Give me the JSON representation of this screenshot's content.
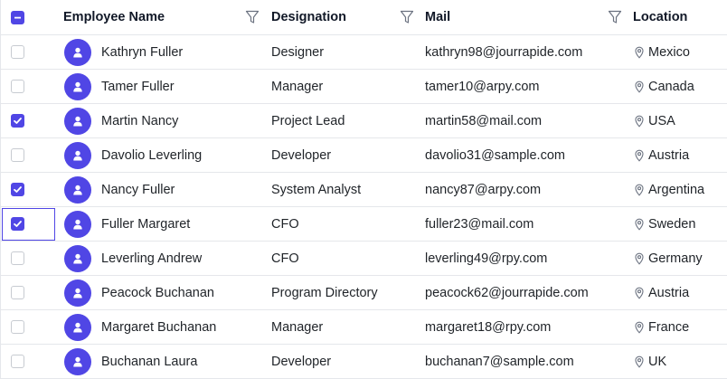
{
  "header": {
    "name": "Employee Name",
    "designation": "Designation",
    "mail": "Mail",
    "location": "Location"
  },
  "colors": {
    "accent": "#5046e5",
    "border": "#e5e7eb"
  },
  "icons": {
    "filter": "filter-icon",
    "avatar": "user-icon",
    "location": "map-pin-icon",
    "check": "check-icon"
  },
  "rows": [
    {
      "name": "Kathryn Fuller",
      "designation": "Designer",
      "mail": "kathryn98@jourrapide.com",
      "location": "Mexico",
      "checked": false
    },
    {
      "name": "Tamer Fuller",
      "designation": "Manager",
      "mail": "tamer10@arpy.com",
      "location": "Canada",
      "checked": false
    },
    {
      "name": "Martin Nancy",
      "designation": "Project Lead",
      "mail": "martin58@mail.com",
      "location": "USA",
      "checked": true
    },
    {
      "name": "Davolio Leverling",
      "designation": "Developer",
      "mail": "davolio31@sample.com",
      "location": "Austria",
      "checked": false
    },
    {
      "name": "Nancy Fuller",
      "designation": "System Analyst",
      "mail": "nancy87@arpy.com",
      "location": "Argentina",
      "checked": true
    },
    {
      "name": "Fuller Margaret",
      "designation": "CFO",
      "mail": "fuller23@mail.com",
      "location": "Sweden",
      "checked": true,
      "focused": true
    },
    {
      "name": "Leverling Andrew",
      "designation": "CFO",
      "mail": "leverling49@rpy.com",
      "location": "Germany",
      "checked": false
    },
    {
      "name": "Peacock Buchanan",
      "designation": "Program Directory",
      "mail": "peacock62@jourrapide.com",
      "location": "Austria",
      "checked": false
    },
    {
      "name": "Margaret Buchanan",
      "designation": "Manager",
      "mail": "margaret18@rpy.com",
      "location": "France",
      "checked": false
    },
    {
      "name": "Buchanan Laura",
      "designation": "Developer",
      "mail": "buchanan7@sample.com",
      "location": "UK",
      "checked": false
    }
  ]
}
